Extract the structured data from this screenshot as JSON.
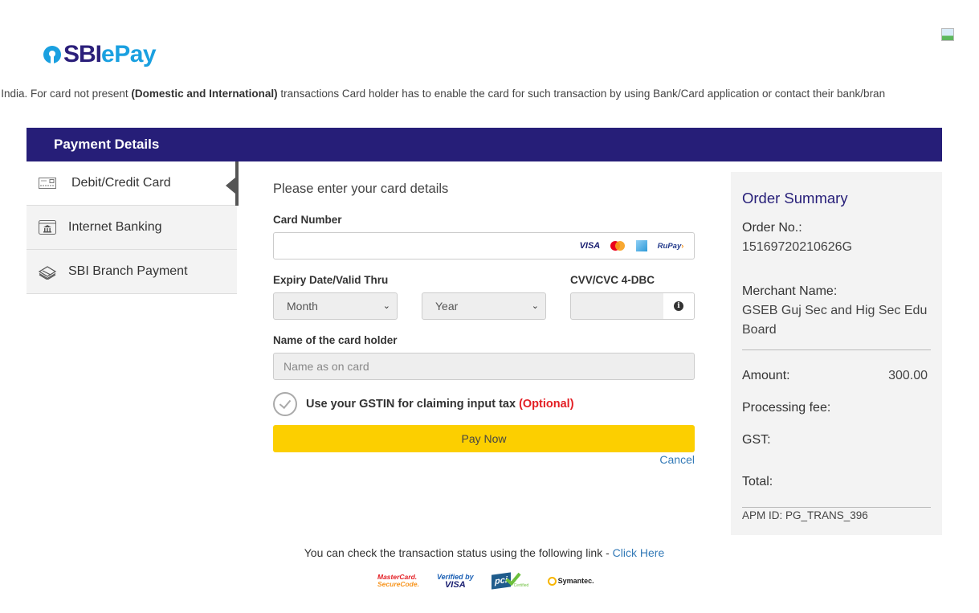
{
  "brand": {
    "logo_primary": "SBI",
    "logo_secondary": "ePay",
    "colors": {
      "primary_navy": "#261e78",
      "brand_blue": "#1aa0e0",
      "pay_button": "#fccf00",
      "optional_red": "#e31e24",
      "link_blue": "#337ab7"
    }
  },
  "notice": {
    "before": "n India. For card not present ",
    "bold": "(Domestic and International)",
    "after": " transactions Card holder has to enable the card for such transaction by using Bank/Card application or contact their bank/bran"
  },
  "header": {
    "title": "Payment Details"
  },
  "sidebar": {
    "items": [
      {
        "label": "Debit/Credit Card",
        "icon": "credit-card-icon",
        "active": true
      },
      {
        "label": "Internet Banking",
        "icon": "bank-icon",
        "active": false
      },
      {
        "label": "SBI Branch Payment",
        "icon": "cash-stack-icon",
        "active": false
      }
    ]
  },
  "form": {
    "title": "Please enter your card details",
    "card_number": {
      "label": "Card Number",
      "value": "",
      "accepted_networks": [
        "VISA",
        "Mastercard",
        "American Express",
        "RuPay"
      ]
    },
    "expiry": {
      "label": "Expiry Date/Valid Thru",
      "month_selected": "Month",
      "year_selected": "Year"
    },
    "cvv": {
      "label": "CVV/CVC 4-DBC",
      "value": "",
      "info_icon": "info-circle-icon"
    },
    "cardholder": {
      "label": "Name of the card holder",
      "placeholder": "Name as on card",
      "value": ""
    },
    "gst": {
      "label": "Use your GSTIN for claiming input tax",
      "optional": "(Optional)",
      "checked": false
    },
    "pay_button": "Pay Now",
    "cancel_link": "Cancel",
    "visa_text": "VISA",
    "rupay_text": "RuPay",
    "rupay_arrow": "›"
  },
  "order_summary": {
    "title": "Order Summary",
    "order_no_label": "Order No.:",
    "order_no": "15169720210626G",
    "merchant_label": "Merchant Name:",
    "merchant_name": "GSEB Guj Sec and Hig Sec Edu Board",
    "amount_label": "Amount:",
    "amount": "300.00",
    "processing_fee_label": "Processing fee:",
    "processing_fee": "",
    "gst_label": "GST:",
    "gst": "",
    "total_label": "Total:",
    "total": "",
    "apm_id": "APM ID: PG_TRANS_396"
  },
  "footer": {
    "status_text": "You can check the transaction status using the following link - ",
    "status_link": "Click Here",
    "trust_badges": {
      "mastercard_line1": "MasterCard.",
      "mastercard_line2": "SecureCode.",
      "vbv_line1": "Verified by",
      "vbv_line2": "VISA",
      "pci_text": "pci",
      "pci_certified": "Certified",
      "symantec": "Symantec."
    }
  }
}
